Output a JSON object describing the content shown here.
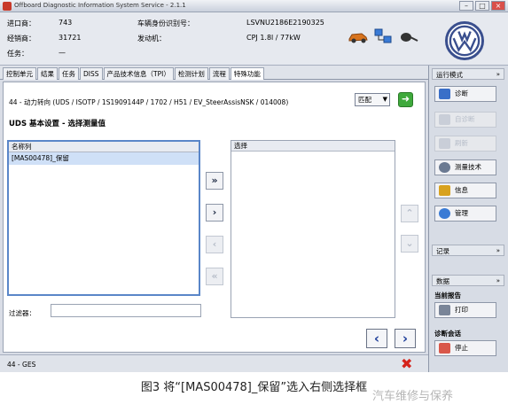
{
  "window": {
    "title": "Offboard Diagnostic Information System Service - 2.1.1"
  },
  "header": {
    "labels": {
      "import_no": "进口商：",
      "dealer_no": "经销商：",
      "task": "任务：",
      "vin": "车辆身份识别号：",
      "engine": "发动机："
    },
    "values": {
      "import_no": "743",
      "dealer_no": "31721",
      "task": "—",
      "vin": "LSVNU2186E2190325",
      "engine": "CPJ 1.8l / 77kW"
    }
  },
  "tabs": [
    {
      "label": "控制单元",
      "active": false
    },
    {
      "label": "结果",
      "active": false
    },
    {
      "label": "任务",
      "active": false
    },
    {
      "label": "DISS",
      "active": false
    },
    {
      "label": "产品技术信息（TPI）",
      "active": false
    },
    {
      "label": "检测计划",
      "active": false
    },
    {
      "label": "流程",
      "active": false
    },
    {
      "label": "特殊功能",
      "active": true
    }
  ],
  "main": {
    "breadcrumb": "44 - 动力转向 (UDS / ISOTP / 1S1909144P / 1702 / H51 / EV_SteerAssisNSK / 014008)",
    "match_select": "匹配",
    "panel_title": "UDS 基本设置 - 选择测量值",
    "left_list": {
      "header": "名称列",
      "rows": [
        "[MAS00478]_保留"
      ]
    },
    "right_list": {
      "header": "选择",
      "rows": []
    },
    "filter_label": "过滤器："
  },
  "status_bar": {
    "text": "44 - GES"
  },
  "sidebar": {
    "mode_header": "运行模式",
    "buttons": {
      "diagnosis": "诊断",
      "self_diag": "自诊断",
      "flash": "刷新",
      "measure": "测量技术",
      "info": "信息",
      "admin": "管理"
    },
    "record_header": "记录",
    "data_label": "数据",
    "current_report": "当前报告",
    "print": "打印",
    "diag_session": "诊断会话",
    "stop": "停止"
  },
  "caption": {
    "text": "图3 将“[MAS00478]_保留”选入右侧选择框",
    "watermark": "汽车维修与保养"
  },
  "colors": {
    "accent_blue": "#5a86c8",
    "go_green": "#3fa93c",
    "cancel_red": "#d5231b",
    "nav_blue": "#1f3f9a"
  }
}
